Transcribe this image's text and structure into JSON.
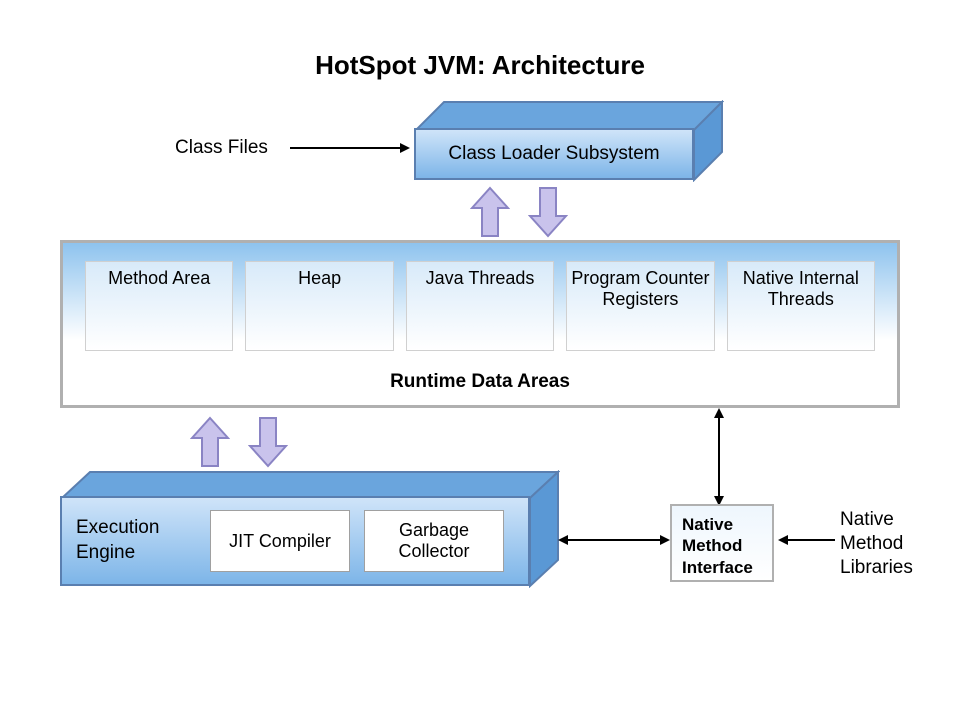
{
  "title": "HotSpot JVM: Architecture",
  "class_files_label": "Class Files",
  "class_loader": {
    "label": "Class Loader Subsystem"
  },
  "runtime": {
    "caption": "Runtime Data Areas",
    "cells": [
      "Method Area",
      "Heap",
      "Java Threads",
      "Program Counter Registers",
      "Native Internal Threads"
    ]
  },
  "execution_engine": {
    "label": "Execution Engine",
    "jit": "JIT Compiler",
    "gc": "Garbage Collector"
  },
  "native_method_interface": "Native Method Interface",
  "native_method_libraries": "Native Method Libraries"
}
